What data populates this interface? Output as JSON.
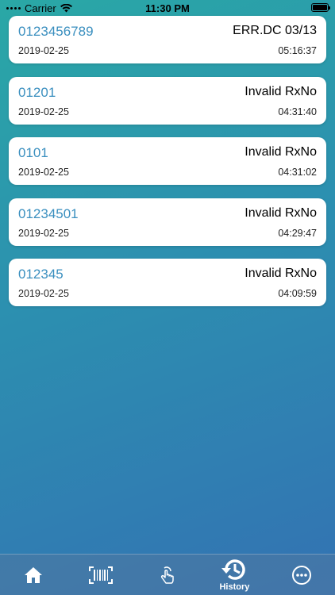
{
  "status_bar": {
    "carrier": "Carrier",
    "time": "11:30 PM"
  },
  "history": [
    {
      "rx": "0123456789",
      "status": "ERR.DC 03/13",
      "date": "2019-02-25",
      "time": "05:16:37"
    },
    {
      "rx": "01201",
      "status": "Invalid RxNo",
      "date": "2019-02-25",
      "time": "04:31:40"
    },
    {
      "rx": "0101",
      "status": "Invalid RxNo",
      "date": "2019-02-25",
      "time": "04:31:02"
    },
    {
      "rx": "01234501",
      "status": "Invalid RxNo",
      "date": "2019-02-25",
      "time": "04:29:47"
    },
    {
      "rx": "012345",
      "status": "Invalid RxNo",
      "date": "2019-02-25",
      "time": "04:09:59"
    }
  ],
  "tabbar": {
    "tabs": [
      {
        "icon": "home-icon",
        "label": ""
      },
      {
        "icon": "barcode-scan-icon",
        "label": ""
      },
      {
        "icon": "hand-tap-icon",
        "label": ""
      },
      {
        "icon": "history-icon",
        "label": "History",
        "selected": true
      },
      {
        "icon": "more-icon",
        "label": ""
      }
    ]
  },
  "colors": {
    "rx_number": "#3a8fbf",
    "gradient_start": "#2aa8a6",
    "gradient_end": "#3372b3"
  }
}
